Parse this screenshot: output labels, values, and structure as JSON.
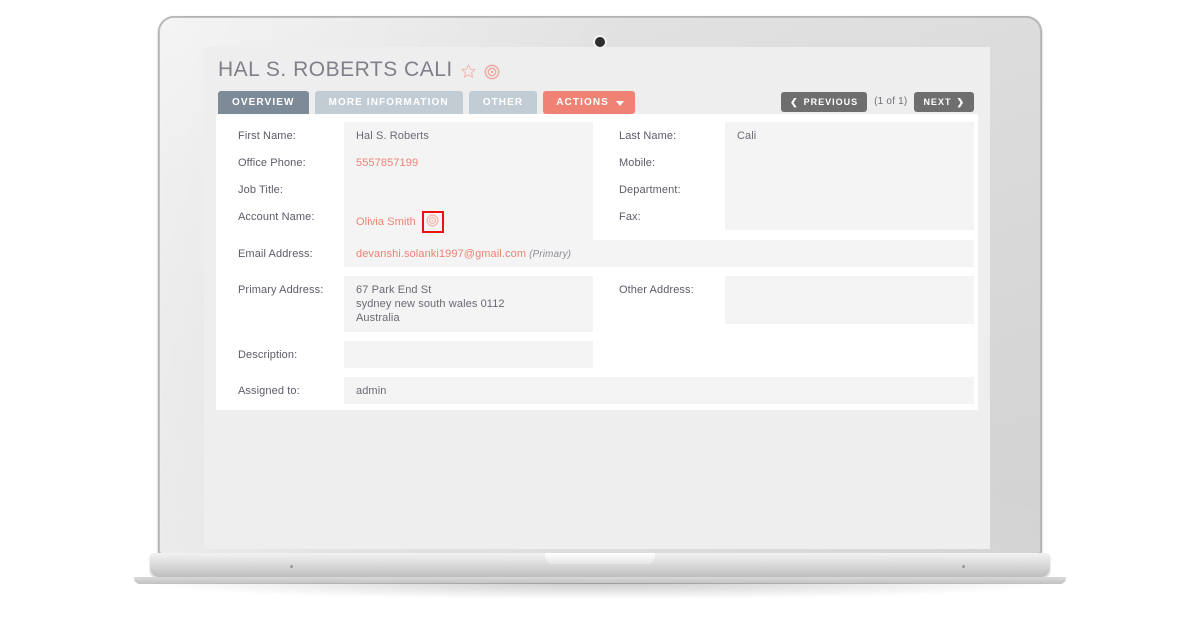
{
  "record": {
    "title": "HAL S. ROBERTS CALI",
    "favorite_icon": "star-outline-icon",
    "target_icon": "target-icon"
  },
  "tabs": [
    {
      "label": "OVERVIEW",
      "state": "active"
    },
    {
      "label": "MORE INFORMATION",
      "state": "inactive"
    },
    {
      "label": "OTHER",
      "state": "inactive"
    }
  ],
  "actions": {
    "label": "ACTIONS",
    "caret_icon": "chevron-down-icon"
  },
  "pager": {
    "previous_label": "PREVIOUS",
    "previous_icon": "chevron-left-icon",
    "count_label": "(1 of 1)",
    "next_label": "NEXT",
    "next_icon": "chevron-right-icon"
  },
  "fields": {
    "first_name": {
      "label": "First Name:",
      "value": "Hal S. Roberts"
    },
    "last_name": {
      "label": "Last Name:",
      "value": "Cali"
    },
    "office_phone": {
      "label": "Office Phone:",
      "value": "5557857199"
    },
    "mobile": {
      "label": "Mobile:",
      "value": ""
    },
    "job_title": {
      "label": "Job Title:",
      "value": ""
    },
    "department": {
      "label": "Department:",
      "value": ""
    },
    "account_name": {
      "label": "Account Name:",
      "value": "Olivia Smith",
      "inline_icon": "target-icon"
    },
    "fax": {
      "label": "Fax:",
      "value": ""
    },
    "email_address": {
      "label": "Email Address:",
      "value": "devanshi.solanki1997@gmail.com",
      "note": "(Primary)"
    },
    "primary_address": {
      "label": "Primary Address:",
      "value": "67 Park End St\nsydney new south wales  0112\nAustralia"
    },
    "other_address": {
      "label": "Other Address:",
      "value": ""
    },
    "description": {
      "label": "Description:",
      "value": ""
    },
    "assigned_to": {
      "label": "Assigned to:",
      "value": "admin"
    }
  },
  "colors": {
    "accent": "#ef8274",
    "tab_active": "#7d8a98",
    "tab_inactive": "#c2ccd4",
    "pager": "#6e6e6e",
    "highlight_box": "#ee1111",
    "field_bg": "#f4f4f4",
    "label_text": "#5c5c68",
    "page_bg": "#eeeeee"
  }
}
